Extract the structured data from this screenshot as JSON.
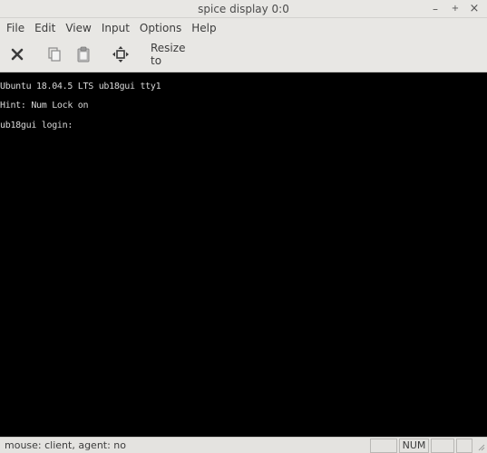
{
  "window": {
    "title": "spice display 0:0",
    "controls": {
      "minimize_icon": "minimize-icon",
      "maximize_icon": "maximize-icon",
      "close_icon": "close-icon"
    }
  },
  "menubar": {
    "items": [
      "File",
      "Edit",
      "View",
      "Input",
      "Options",
      "Help"
    ]
  },
  "toolbar": {
    "disconnect_icon": "x-icon",
    "copy_icon": "copy-icon",
    "paste_icon": "paste-icon",
    "move_icon": "move-arrows-icon",
    "resize_label": "Resize to"
  },
  "terminal": {
    "lines": [
      "Ubuntu 18.04.5 LTS ub18gui tty1",
      "Hint: Num Lock on",
      "ub18gui login:"
    ],
    "background": "#000000",
    "foreground": "#d8d8d8"
  },
  "statusbar": {
    "text": "mouse: client, agent: no",
    "num_indicator": "NUM"
  }
}
